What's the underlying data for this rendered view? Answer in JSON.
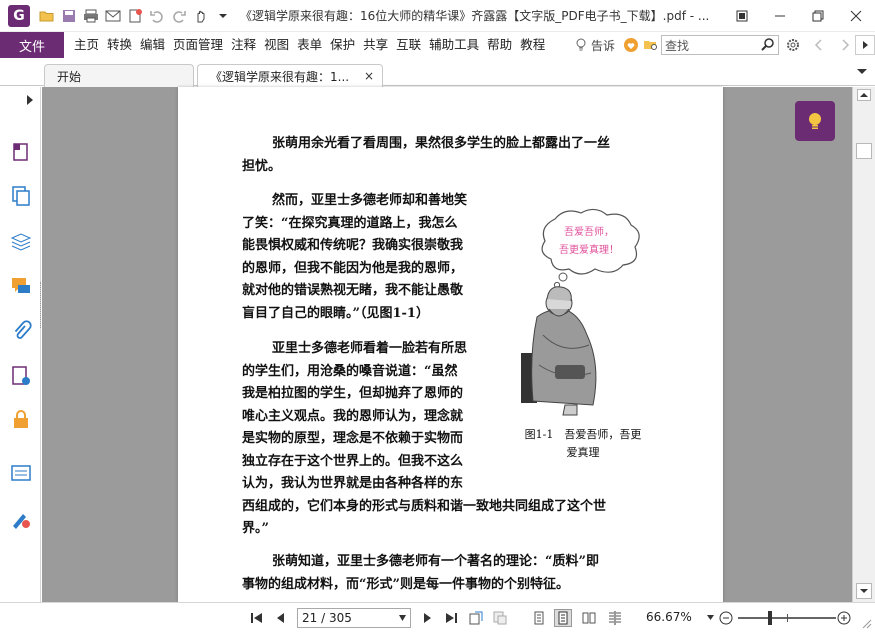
{
  "window": {
    "app_logo": "G",
    "title": "《逻辑学原来很有趣：16位大师的精华课》齐露露【文字版_PDF电子书_下载】.pdf - ..."
  },
  "menu": {
    "file_label": "文件",
    "items": [
      "主页",
      "转换",
      "编辑",
      "页面管理",
      "注释",
      "视图",
      "表单",
      "保护",
      "共享",
      "互联",
      "辅助工具",
      "帮助",
      "教程"
    ],
    "tell_me": "告诉",
    "search_placeholder": "查找"
  },
  "tabs": [
    {
      "label": "开始"
    },
    {
      "label": "《逻辑学原来很有趣：1...",
      "close": "×"
    }
  ],
  "page": {
    "para1": [
      "张萌用余光看了看周围，果然很多学生的脸上都露出了一丝",
      "担忧。"
    ],
    "para2": [
      "然而，亚里士多德老师却和善地笑",
      "了笑：“在探究真理的道路上，我怎么",
      "能畏惧权威和传统呢？我确实很崇敬我",
      "的恩师，但我不能因为他是我的恩师，",
      "就对他的错误熟视无睹，我不能让愚敬",
      "盲目了自己的眼睛。”（见图1-1）"
    ],
    "para3": [
      "亚里士多德老师看着一脸若有所思",
      "的学生们，用沧桑的嗓音说道：“虽然",
      "我是柏拉图的学生，但却抛弃了恩师的",
      "唯心主义观点。我的恩师认为，理念就",
      "是实物的原型，理念是不依赖于实物而",
      "独立存在于这个世界上的。但我不这么",
      "认为，我认为世界就是由各种各样的东",
      "西组成的，它们本身的形式与质料和谐一致地共同组成了这个世",
      "界。”"
    ],
    "para4": [
      "张萌知道，亚里士多德老师有一个著名的理论：“质料”即",
      "事物的组成材料，而“形式”则是每一件事物的个别特征。"
    ],
    "bubble": [
      "吾爱吾师，",
      "吾更爱真理！"
    ],
    "caption": [
      "图1-1　吾爱吾师，吾更",
      "爱真理"
    ]
  },
  "status": {
    "page_value": "21 / 305",
    "zoom": "66.67%"
  },
  "colors": {
    "brand": "#6b2c73",
    "doc_background": "#9b9b9b",
    "bubble_text": "#e0509a"
  },
  "icons": [
    "app-logo-icon",
    "open-folder-icon",
    "save-icon",
    "print-icon",
    "email-icon",
    "new-doc-icon",
    "undo-icon",
    "redo-icon",
    "hand-tool-icon",
    "bulb-icon",
    "heart-icon",
    "folder-search-icon",
    "settings-icon",
    "search-icon",
    "minimize-icon",
    "restore-icon",
    "close-icon",
    "pages-icon",
    "copy-pages-icon",
    "layers-icon",
    "comments-icon",
    "attachment-icon",
    "signature-icon",
    "security-icon",
    "form-fields-icon",
    "certificate-icon",
    "first-page-icon",
    "prev-page-icon",
    "next-page-icon",
    "last-page-icon",
    "single-page-icon",
    "continuous-page-icon",
    "facing-icon",
    "scroll-facing-icon",
    "zoom-out-icon",
    "zoom-in-icon"
  ]
}
